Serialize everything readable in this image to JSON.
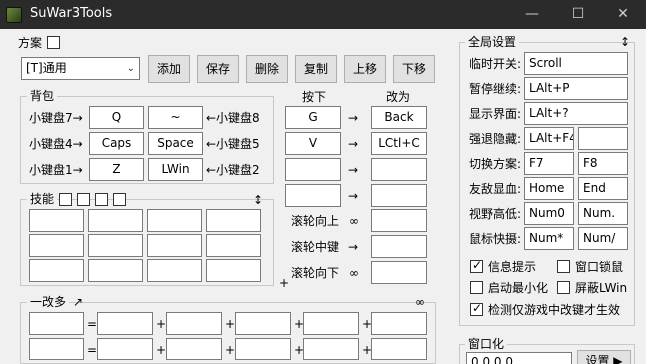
{
  "window": {
    "title": "SuWar3Tools",
    "minimize": "—",
    "maximize": "☐",
    "close": "✕"
  },
  "scheme": {
    "title": "方案",
    "selected": "[T]通用",
    "buttons": {
      "add": "添加",
      "save": "保存",
      "delete": "删除",
      "copy": "复制",
      "move_up": "上移",
      "move_down": "下移"
    }
  },
  "backpack": {
    "title": "背包",
    "rows": [
      {
        "left_label": "小键盘7→",
        "key1": "Q",
        "key2": "~",
        "right_label": "←小键盘8"
      },
      {
        "left_label": "小键盘4→",
        "key1": "Caps",
        "key2": "Space",
        "right_label": "←小键盘5"
      },
      {
        "left_label": "小键盘1→",
        "key1": "Z",
        "key2": "LWin",
        "right_label": "←小键盘2"
      }
    ]
  },
  "remap": {
    "press_header": "按下",
    "to_header": "改为",
    "arrow": "→",
    "rows": [
      {
        "from": "G",
        "to": "Back"
      },
      {
        "from": "V",
        "to": "LCtl+C"
      },
      {
        "from": "",
        "to": ""
      },
      {
        "from": "",
        "to": ""
      }
    ],
    "wheel": [
      {
        "label": "滚轮向上",
        "symbol": "∞"
      },
      {
        "label": "滚轮中键",
        "symbol": "→"
      },
      {
        "label": "滚轮向下",
        "symbol": "∞"
      }
    ],
    "plus": "+"
  },
  "skills": {
    "title": "技能",
    "sort_icon": "↕"
  },
  "combo": {
    "title": "一改多",
    "link_icon": "↗",
    "infinity": "∞",
    "eq": "=",
    "plus": "+"
  },
  "global": {
    "title": "全局设置",
    "sort_icon": "↕",
    "rows": [
      {
        "label": "临时开关:",
        "value": "Scroll"
      },
      {
        "label": "暂停继续:",
        "value": "LAlt+P"
      },
      {
        "label": "显示界面:",
        "value": "LAlt+?"
      },
      {
        "label": "强退隐藏:",
        "value": "LAlt+F4",
        "value2": ""
      },
      {
        "label": "切换方案:",
        "value": "F7",
        "value2": "F8"
      },
      {
        "label": "友敌显血:",
        "value": "Home",
        "value2": "End"
      },
      {
        "label": "视野高低:",
        "value": "Num0",
        "value2": "Num."
      },
      {
        "label": "鼠标快摄:",
        "value": "Num*",
        "value2": "Num/"
      }
    ],
    "checkboxes": {
      "info_tip": "信息提示",
      "window_lock": "窗口锁鼠",
      "auto_minimize": "启动最小化",
      "block_lwin": "屏蔽LWin",
      "detect_ingame": "检测仅游戏中改键才生效"
    }
  },
  "windowing": {
    "title": "窗口化",
    "value": "0,0,0,0",
    "settings_button": "设置 ▶"
  }
}
